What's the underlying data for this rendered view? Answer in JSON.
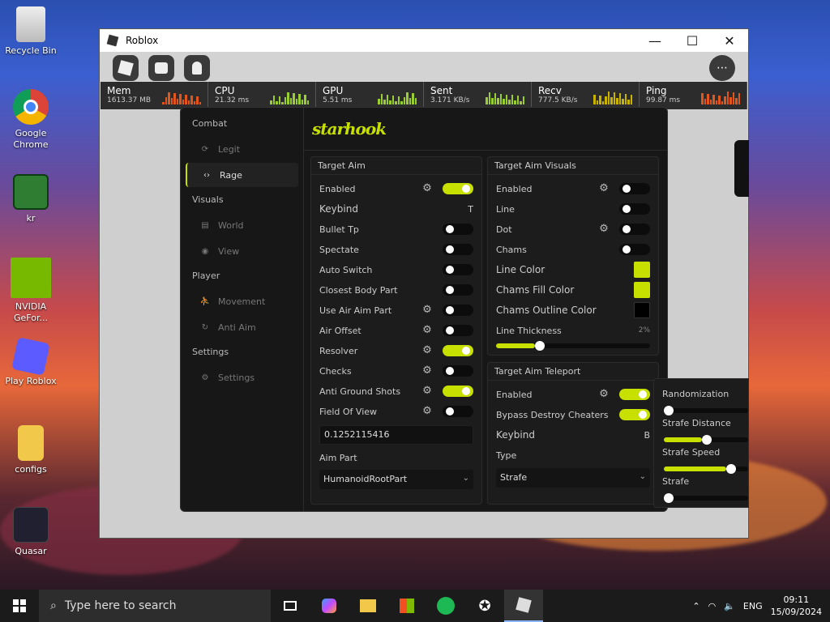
{
  "desktop": {
    "icons": [
      {
        "name": "recycle-bin",
        "label": "Recycle Bin"
      },
      {
        "name": "chrome",
        "label": "Google Chrome"
      },
      {
        "name": "kr",
        "label": "kr"
      },
      {
        "name": "nvidia",
        "label": "NVIDIA GeFor..."
      },
      {
        "name": "play-roblox",
        "label": "Play Roblox"
      },
      {
        "name": "configs",
        "label": "configs"
      },
      {
        "name": "quasar",
        "label": "Quasar"
      }
    ]
  },
  "window": {
    "title": "Roblox",
    "controls": {
      "minimize": "—",
      "maximize": "☐",
      "close": "✕"
    }
  },
  "stats": [
    {
      "name": "Mem",
      "value": "1613.37 MB",
      "color": "#e0571d"
    },
    {
      "name": "CPU",
      "value": "21.32 ms",
      "color": "#9acd32"
    },
    {
      "name": "GPU",
      "value": "5.51 ms",
      "color": "#9acd32"
    },
    {
      "name": "Sent",
      "value": "3.171 KB/s",
      "color": "#9acd32"
    },
    {
      "name": "Recv",
      "value": "777.5 KB/s",
      "color": "#c8b400"
    },
    {
      "name": "Ping",
      "value": "99.87 ms",
      "color": "#e0571d"
    }
  ],
  "panel": {
    "brand": "starhook",
    "accent": "#c8e000",
    "sidebar": {
      "sections": [
        {
          "title": "Combat",
          "items": [
            {
              "label": "Legit",
              "icon": "refresh-icon"
            },
            {
              "label": "Rage",
              "icon": "code-icon",
              "active": true
            }
          ]
        },
        {
          "title": "Visuals",
          "items": [
            {
              "label": "World",
              "icon": "map-icon"
            },
            {
              "label": "View",
              "icon": "eye-icon"
            }
          ]
        },
        {
          "title": "Player",
          "items": [
            {
              "label": "Movement",
              "icon": "run-icon"
            },
            {
              "label": "Anti Aim",
              "icon": "rotate-icon"
            }
          ]
        },
        {
          "title": "Settings",
          "items": [
            {
              "label": "Settings",
              "icon": "gear-icon"
            }
          ]
        }
      ]
    },
    "target_aim": {
      "title": "Target Aim",
      "enabled_label": "Enabled",
      "keybind_label": "Keybind",
      "keybind_value": "T",
      "bullet_tp": "Bullet Tp",
      "spectate": "Spectate",
      "auto_switch": "Auto Switch",
      "closest_body_part": "Closest Body Part",
      "use_air_aim_part": "Use Air Aim Part",
      "air_offset": "Air Offset",
      "resolver": "Resolver",
      "checks": "Checks",
      "anti_ground_shots": "Anti Ground Shots",
      "field_of_view": "Field Of View",
      "fov_value": "0.1252115416",
      "aim_part_label": "Aim Part",
      "aim_part_value": "HumanoidRootPart"
    },
    "target_aim_visuals": {
      "title": "Target Aim Visuals",
      "enabled_label": "Enabled",
      "line": "Line",
      "dot": "Dot",
      "chams": "Chams",
      "line_color": "Line Color",
      "chams_fill_color": "Chams Fill Color",
      "chams_outline_color": "Chams Outline Color",
      "line_thickness": "Line Thickness",
      "line_thickness_value": "2%",
      "line_thickness_fraction": 0.25,
      "line_color_hex": "#c8e000",
      "chams_fill_hex": "#c8e000",
      "chams_outline_hex": "#000000"
    },
    "target_aim_teleport": {
      "title": "Target Aim Teleport",
      "enabled_label": "Enabled",
      "bypass": "Bypass Destroy Cheaters",
      "keybind_label": "Keybind",
      "keybind_value": "B",
      "type_label": "Type",
      "type_value": "Strafe"
    },
    "popout": {
      "randomization": "Randomization",
      "randomization_fraction": 0.0,
      "strafe_distance": "Strafe Distance",
      "strafe_distance_fraction": 0.45,
      "strafe_speed": "Strafe Speed",
      "strafe_speed_fraction": 0.74,
      "strafe": "Strafe",
      "strafe_fraction": 0.0
    }
  },
  "taskbar": {
    "search_placeholder": "Type here to search",
    "language": "ENG",
    "time": "09:11",
    "date": "15/09/2024"
  }
}
